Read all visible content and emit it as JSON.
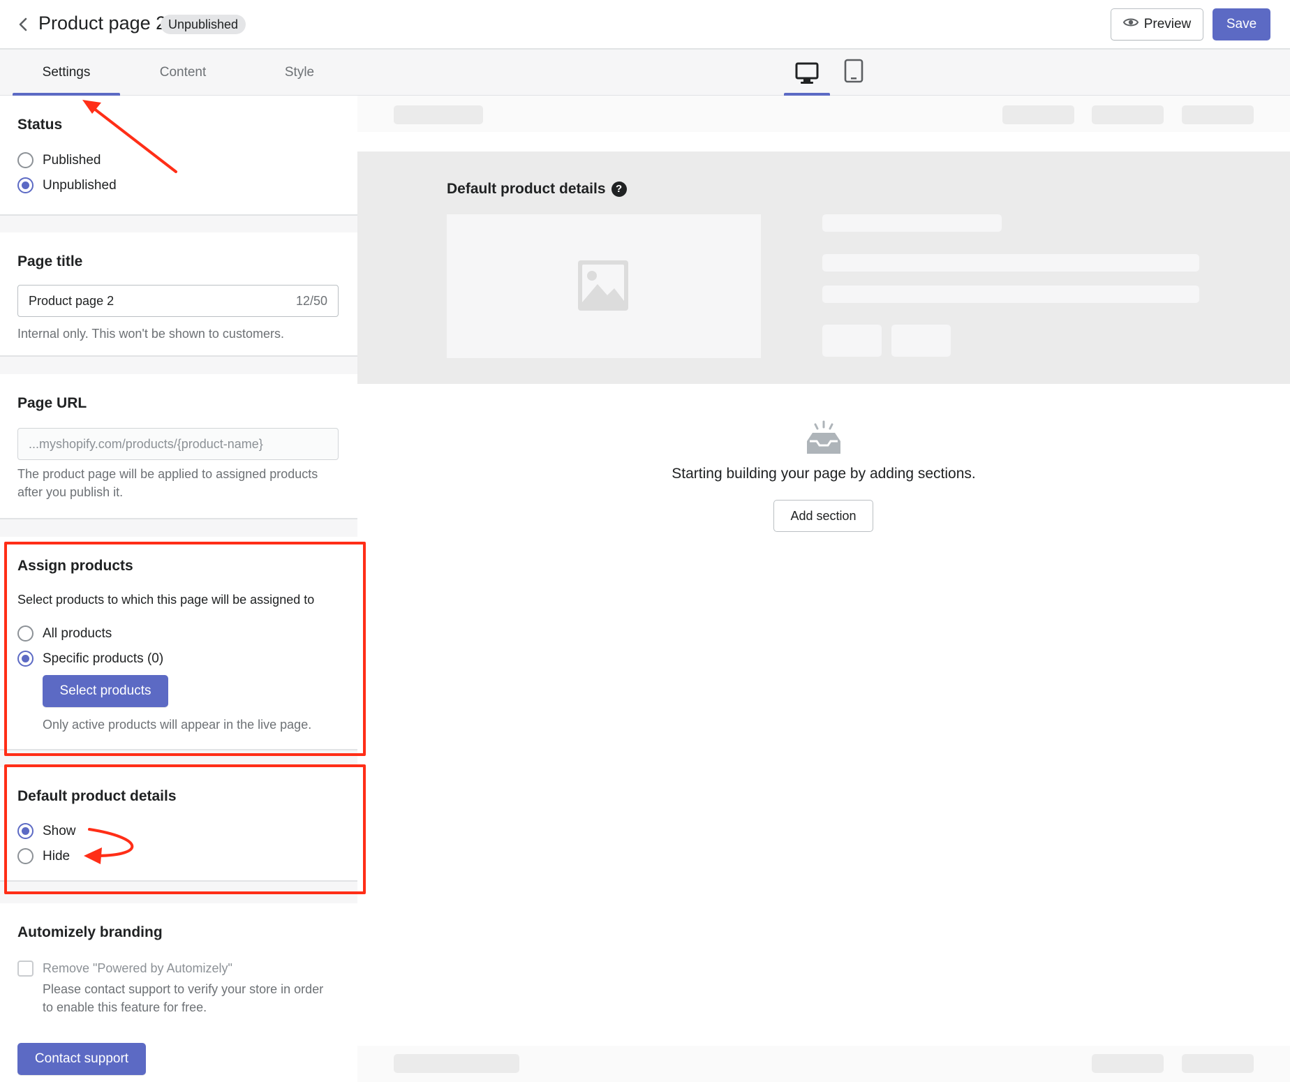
{
  "header": {
    "title": "Product page 2",
    "status_badge": "Unpublished",
    "preview_label": "Preview",
    "save_label": "Save"
  },
  "tabs": [
    {
      "label": "Settings",
      "active": true
    },
    {
      "label": "Content",
      "active": false
    },
    {
      "label": "Style",
      "active": false
    }
  ],
  "devices": {
    "desktop_icon": "desktop-icon",
    "tablet_icon": "tablet-icon",
    "selected": "desktop"
  },
  "status": {
    "heading": "Status",
    "options": [
      {
        "label": "Published",
        "selected": false
      },
      {
        "label": "Unpublished",
        "selected": true
      }
    ]
  },
  "page_title": {
    "heading": "Page title",
    "value": "Product page 2",
    "counter": "12/50",
    "help": "Internal only. This won't be shown to customers."
  },
  "page_url": {
    "heading": "Page URL",
    "value": "...myshopify.com/products/{product-name}",
    "help": "The product page will be applied to assigned products after you publish it."
  },
  "assign_products": {
    "heading": "Assign products",
    "description": "Select products to which this page will be assigned to",
    "options": [
      {
        "label": "All products",
        "selected": false
      },
      {
        "label": "Specific products (0)",
        "selected": true
      }
    ],
    "button_label": "Select products",
    "note": "Only active products will appear in the live page."
  },
  "default_details": {
    "heading": "Default product details",
    "options": [
      {
        "label": "Show",
        "selected": true
      },
      {
        "label": "Hide",
        "selected": false
      }
    ]
  },
  "branding": {
    "heading": "Automizely branding",
    "checkbox_label": "Remove \"Powered by Automizely\"",
    "checked": false,
    "help": "Please contact support to verify your store in order to enable this feature for free.",
    "button_label": "Contact support"
  },
  "preview": {
    "section_title": "Default product details",
    "empty_text": "Starting building your page by adding sections.",
    "add_section_label": "Add section"
  },
  "colors": {
    "accent": "#5c6ac4",
    "annotation": "#ff2e17"
  }
}
